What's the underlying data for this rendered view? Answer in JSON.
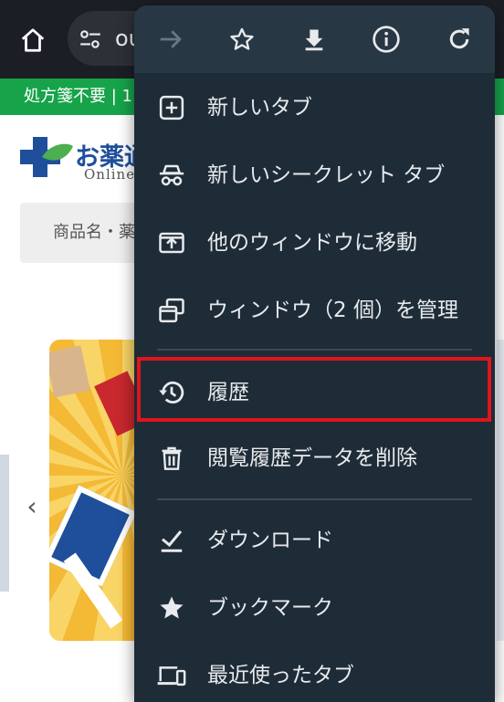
{
  "browser": {
    "url_fragment": "ou",
    "icons": {
      "home": "home-icon",
      "tune": "tune-icon"
    }
  },
  "page": {
    "promo_text": "処方箋不要 | 1",
    "logo_text": "お薬通",
    "logo_subtext": "Online",
    "search_placeholder": "商品名・薬",
    "carousel_prev_glyph": "‹"
  },
  "menu": {
    "toolbar": [
      {
        "name": "forward-button",
        "icon": "arrow-forward-icon",
        "enabled": false
      },
      {
        "name": "bookmark-star-button",
        "icon": "star-outline-icon",
        "enabled": true
      },
      {
        "name": "download-page-button",
        "icon": "download-icon",
        "enabled": true
      },
      {
        "name": "page-info-button",
        "icon": "info-icon",
        "enabled": true
      },
      {
        "name": "reload-button",
        "icon": "refresh-icon",
        "enabled": true
      }
    ],
    "items": [
      {
        "label": "新しいタブ",
        "icon": "new-tab-icon"
      },
      {
        "label": "新しいシークレット タブ",
        "icon": "incognito-icon"
      },
      {
        "label": "他のウィンドウに移動",
        "icon": "move-to-window-icon"
      },
      {
        "label": "ウィンドウ（2 個）を管理",
        "icon": "manage-windows-icon"
      },
      {
        "label": "履歴",
        "icon": "history-icon",
        "highlighted": true
      },
      {
        "label": "閲覧履歴データを削除",
        "icon": "trash-icon"
      },
      {
        "label": "ダウンロード",
        "icon": "downloads-check-icon"
      },
      {
        "label": "ブックマーク",
        "icon": "star-filled-icon"
      },
      {
        "label": "最近使ったタブ",
        "icon": "recent-tabs-icon"
      }
    ]
  },
  "colors": {
    "menu_bg": "#1e2c37",
    "menu_toolbar_bg": "#273844",
    "menu_text": "#e8eaed",
    "highlight_border": "#e0141c",
    "promo_strip": "#16a34a"
  }
}
